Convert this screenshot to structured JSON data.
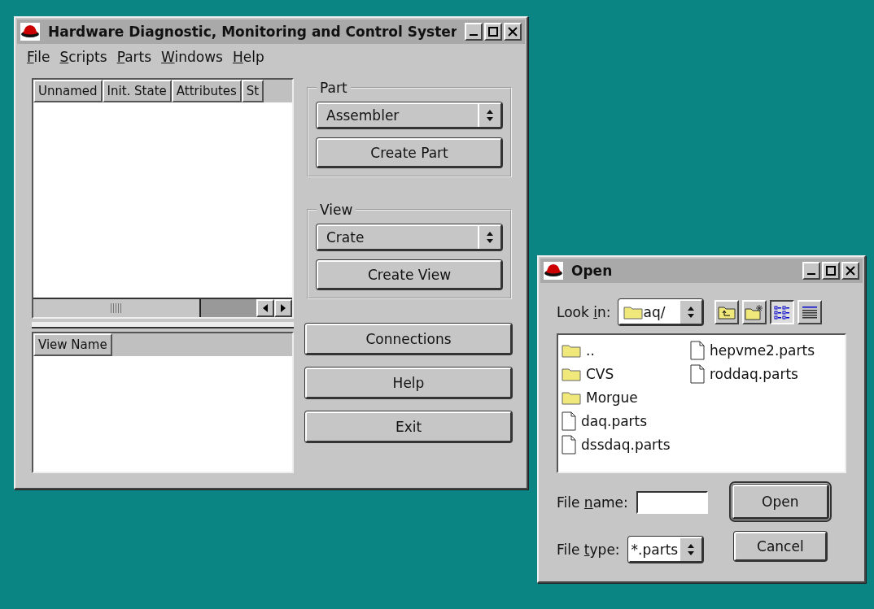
{
  "main_window": {
    "title": "Hardware Diagnostic, Monitoring and Control Syster",
    "menu": [
      {
        "label": {
          "key": "F",
          "after": "ile"
        }
      },
      {
        "label": {
          "key": "S",
          "after": "cripts"
        }
      },
      {
        "label": {
          "key": "P",
          "after": "arts"
        }
      },
      {
        "label": {
          "key": "W",
          "after": "indows"
        }
      },
      {
        "label": {
          "key": "H",
          "after": "elp"
        }
      }
    ],
    "parts_table": {
      "columns": [
        "Unnamed",
        "Init. State",
        "Attributes",
        "St"
      ]
    },
    "views_table": {
      "columns": [
        "View Name"
      ]
    },
    "part_group": {
      "title": "Part",
      "selection": "Assembler",
      "button": "Create Part"
    },
    "view_group": {
      "title": "View",
      "selection": "Crate",
      "button": "Create View"
    },
    "buttons": [
      "Connections",
      "Help",
      "Exit"
    ]
  },
  "open_dialog": {
    "title": "Open",
    "look_in": {
      "label": {
        "before": "Look ",
        "key": "i",
        "after": "n:"
      },
      "value": "aq/"
    },
    "toolbar": [
      {
        "kind": "up",
        "selected": false
      },
      {
        "kind": "new-folder",
        "selected": false
      },
      {
        "kind": "list",
        "selected": true
      },
      {
        "kind": "detail",
        "selected": false
      }
    ],
    "files": [
      {
        "name": "..",
        "kind": "folder"
      },
      {
        "name": "CVS",
        "kind": "folder"
      },
      {
        "name": "Morgue",
        "kind": "folder"
      },
      {
        "name": "daq.parts",
        "kind": "file"
      },
      {
        "name": "dssdaq.parts",
        "kind": "file"
      },
      {
        "name": "hepvme2.parts",
        "kind": "file"
      },
      {
        "name": "roddaq.parts",
        "kind": "file"
      }
    ],
    "file_name": {
      "label": {
        "before": "File ",
        "key": "n",
        "after": "ame:"
      }
    },
    "file_type": {
      "label": {
        "before": "File ",
        "key": "t",
        "after": "ype:"
      },
      "value": "*.parts"
    },
    "buttons": [
      {
        "label": "Open",
        "default": true
      },
      {
        "label": "Cancel",
        "default": false
      }
    ]
  }
}
